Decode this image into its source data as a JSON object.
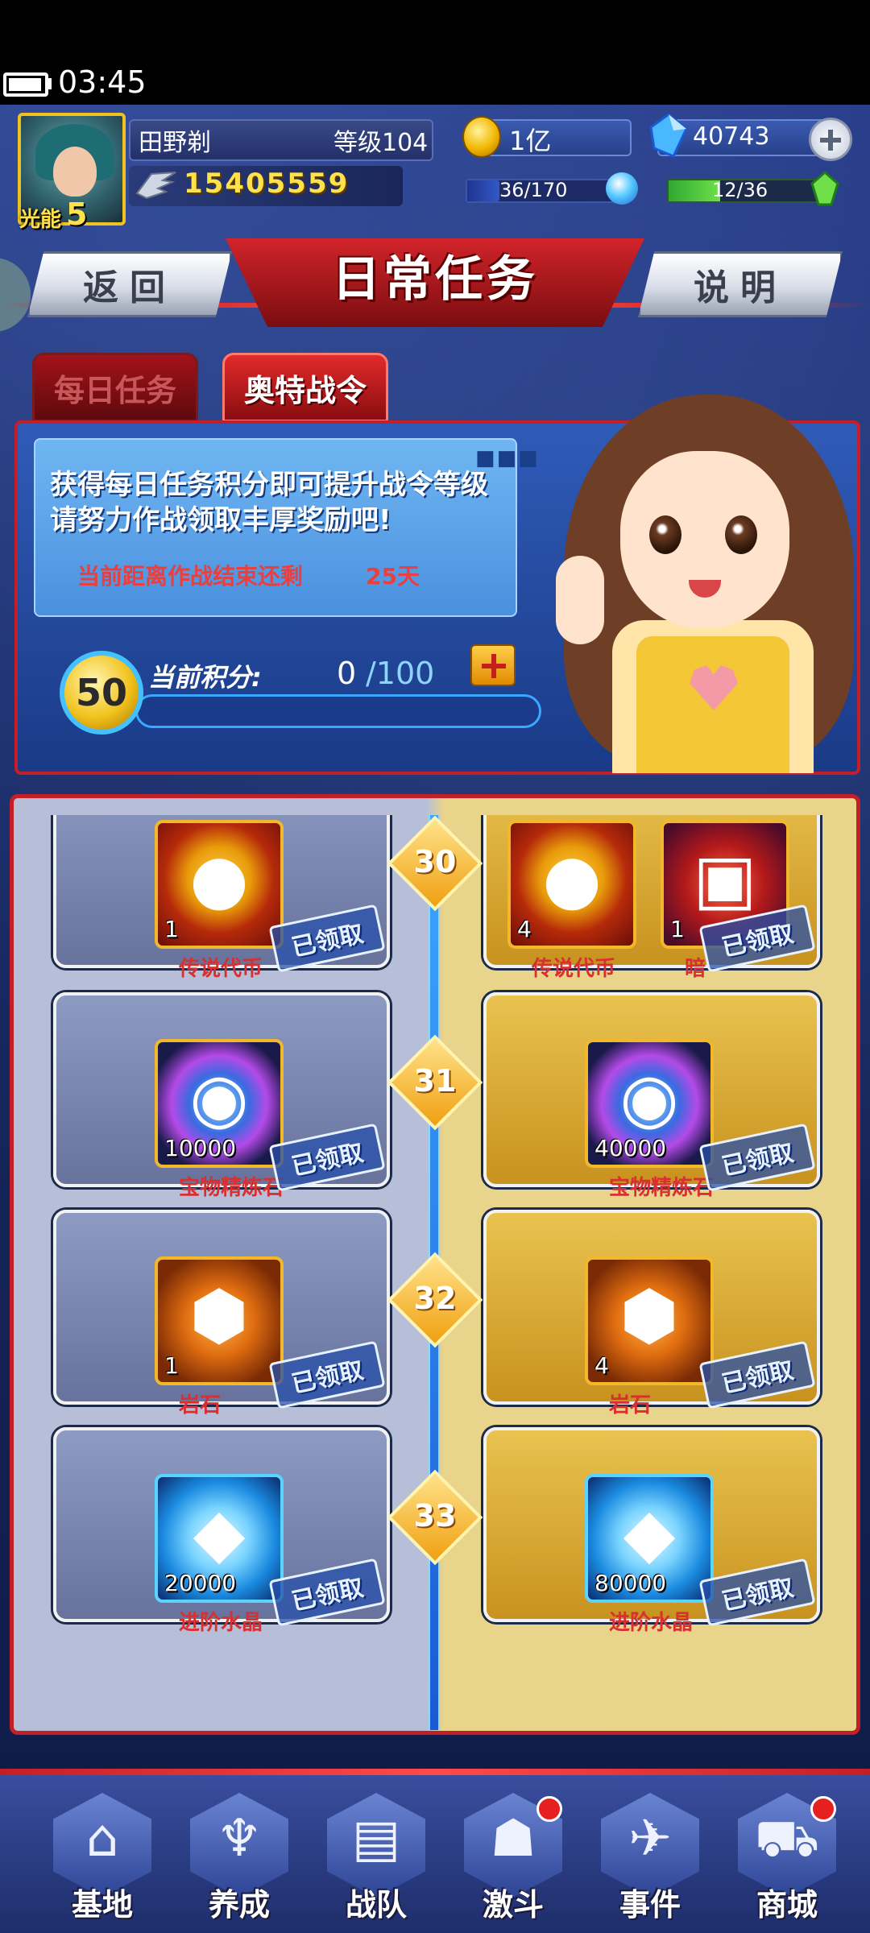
{
  "status_bar": {
    "time": "03:45"
  },
  "player": {
    "energy_label": "光能",
    "energy_value": "5",
    "name": "田野剃",
    "level": "等级104",
    "power": "15405559",
    "coins": "1亿",
    "gems": "40743",
    "stamina": "36/170",
    "stamina_ratio": 0.21,
    "green_resource": "12/36",
    "green_ratio": 0.33
  },
  "header": {
    "title": "日常任务",
    "back_label": "返回",
    "info_label": "说明"
  },
  "tabs": [
    {
      "label": "每日任务",
      "active": false
    },
    {
      "label": "奥特战令",
      "active": true
    }
  ],
  "pass_info": {
    "line1": "获得每日任务积分即可提升战令等级",
    "line2": "请努力作战领取丰厚奖励吧!",
    "remain_label": "当前距离作战结束还剩",
    "remain_value": "25天",
    "level": "50",
    "points_label": "当前积分:",
    "points_value": "0",
    "points_max": "/100",
    "points_ratio": 0
  },
  "rewards": {
    "claimed_label": "已领取",
    "rows": [
      {
        "level": "30",
        "free": [
          {
            "name": "传说代币",
            "qty": "1",
            "icon": "legend-coin-icon"
          }
        ],
        "paid": [
          {
            "name": "传说代币",
            "qty": "4",
            "icon": "legend-coin-icon"
          },
          {
            "name": "暗",
            "qty": "1",
            "icon": "treasure-chest-icon"
          }
        ]
      },
      {
        "level": "31",
        "free": [
          {
            "name": "宝物精炼石",
            "qty": "10000",
            "icon": "refining-stone-icon"
          }
        ],
        "paid": [
          {
            "name": "宝物精炼石",
            "qty": "40000",
            "icon": "refining-stone-icon"
          }
        ]
      },
      {
        "level": "32",
        "free": [
          {
            "name": "岩石",
            "qty": "1",
            "icon": "rock-icon"
          }
        ],
        "paid": [
          {
            "name": "岩石",
            "qty": "4",
            "icon": "rock-icon"
          }
        ]
      },
      {
        "level": "33",
        "free": [
          {
            "name": "进阶水晶",
            "qty": "20000",
            "icon": "crystal-icon"
          }
        ],
        "paid": [
          {
            "name": "进阶水晶",
            "qty": "80000",
            "icon": "crystal-icon"
          }
        ]
      }
    ]
  },
  "nav": [
    {
      "label": "基地",
      "icon": "base-icon",
      "badge": false
    },
    {
      "label": "养成",
      "icon": "training-icon",
      "badge": false
    },
    {
      "label": "战队",
      "icon": "team-cards-icon",
      "badge": false
    },
    {
      "label": "激斗",
      "icon": "battle-icon",
      "badge": true
    },
    {
      "label": "事件",
      "icon": "event-jet-icon",
      "badge": false
    },
    {
      "label": "商城",
      "icon": "shop-cart-icon",
      "badge": true
    }
  ]
}
